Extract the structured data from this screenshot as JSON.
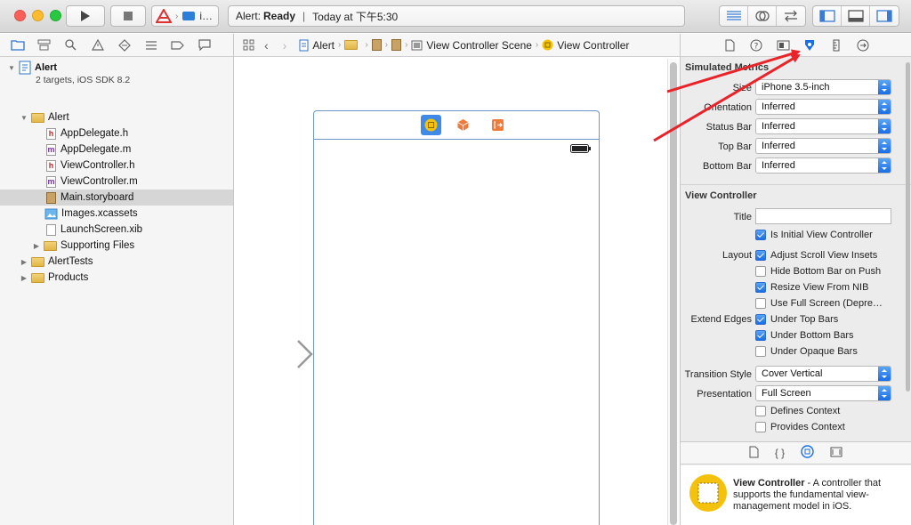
{
  "toolbar": {
    "scheme_label": "i…",
    "activity_prefix": "Alert:",
    "activity_status": "Ready",
    "activity_time": "Today at 下午5:30"
  },
  "navigator": {
    "project_name": "Alert",
    "project_subtitle": "2 targets, iOS SDK 8.2",
    "items": [
      {
        "label": "Alert",
        "kind": "group"
      },
      {
        "label": "AppDelegate.h",
        "kind": "h"
      },
      {
        "label": "AppDelegate.m",
        "kind": "m"
      },
      {
        "label": "ViewController.h",
        "kind": "h"
      },
      {
        "label": "ViewController.m",
        "kind": "m"
      },
      {
        "label": "Main.storyboard",
        "kind": "storyboard"
      },
      {
        "label": "Images.xcassets",
        "kind": "assets"
      },
      {
        "label": "LaunchScreen.xib",
        "kind": "xib"
      },
      {
        "label": "Supporting Files",
        "kind": "group"
      },
      {
        "label": "AlertTests",
        "kind": "group"
      },
      {
        "label": "Products",
        "kind": "group"
      }
    ]
  },
  "jumpbar": {
    "project": "Alert",
    "scene": "View Controller Scene",
    "controller": "View Controller"
  },
  "inspector": {
    "simulated_metrics": {
      "title": "Simulated Metrics",
      "size_label": "Size",
      "size_value": "iPhone 3.5-inch",
      "orientation_label": "Orientation",
      "orientation_value": "Inferred",
      "status_bar_label": "Status Bar",
      "status_bar_value": "Inferred",
      "top_bar_label": "Top Bar",
      "top_bar_value": "Inferred",
      "bottom_bar_label": "Bottom Bar",
      "bottom_bar_value": "Inferred"
    },
    "view_controller": {
      "title": "View Controller",
      "title_label": "Title",
      "title_value": "",
      "initial_vc": "Is Initial View Controller",
      "layout_label": "Layout",
      "adjust_scroll": "Adjust Scroll View Insets",
      "hide_bottom": "Hide Bottom Bar on Push",
      "resize_nib": "Resize View From NIB",
      "full_screen": "Use Full Screen (Depre…",
      "extend_edges_label": "Extend Edges",
      "under_top": "Under Top Bars",
      "under_bottom": "Under Bottom Bars",
      "under_opaque": "Under Opaque Bars",
      "transition_label": "Transition Style",
      "transition_value": "Cover Vertical",
      "presentation_label": "Presentation",
      "presentation_value": "Full Screen",
      "defines_context": "Defines Context",
      "provides_context": "Provides Context",
      "checks": {
        "initial_vc": true,
        "adjust_scroll": true,
        "hide_bottom": false,
        "resize_nib": true,
        "full_screen": false,
        "under_top": true,
        "under_bottom": true,
        "under_opaque": false,
        "defines_context": false,
        "provides_context": false
      }
    },
    "library": {
      "item_name": "View Controller",
      "item_desc": " - A controller that supports the fundamental view-management model in iOS."
    }
  },
  "colors": {
    "accent_blue": "#1a6de6",
    "annotation_red": "#e8232a",
    "scene_border": "#6c97c9",
    "vc_icon_yellow": "#f4c20d"
  }
}
